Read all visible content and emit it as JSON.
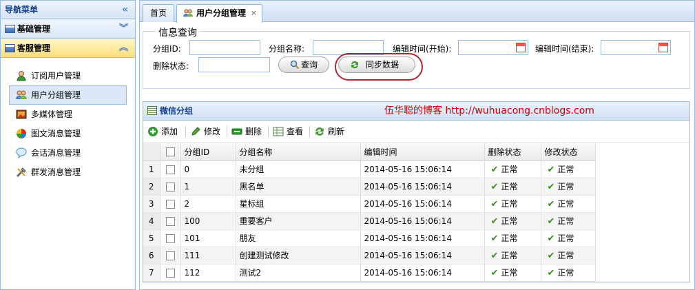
{
  "sidebar": {
    "title": "导航菜单",
    "sections": [
      {
        "label": "基础管理"
      },
      {
        "label": "客服管理"
      }
    ],
    "items": [
      {
        "label": "订阅用户管理"
      },
      {
        "label": "用户分组管理"
      },
      {
        "label": "多媒体管理"
      },
      {
        "label": "图文消息管理"
      },
      {
        "label": "会话消息管理"
      },
      {
        "label": "群发消息管理"
      }
    ]
  },
  "tabs": [
    {
      "label": "首页"
    },
    {
      "label": "用户分组管理"
    }
  ],
  "search": {
    "legend": "信息查询",
    "group_id_label": "分组ID:",
    "group_name_label": "分组名称:",
    "edit_start_label": "编辑时间(开始):",
    "edit_end_label": "编辑时间(结束):",
    "delete_status_label": "删除状态:",
    "query_button": "查询",
    "sync_button": "同步数据"
  },
  "grid": {
    "title": "微信分组",
    "blog_name": "伍华聪的博客",
    "blog_url": "http://wuhuacong.cnblogs.com",
    "toolbar": {
      "add": "添加",
      "edit": "修改",
      "delete": "删除",
      "view": "查看",
      "refresh": "刷新"
    },
    "columns": [
      "分组ID",
      "分组名称",
      "编辑时间",
      "删除状态",
      "修改状态"
    ],
    "rows": [
      {
        "n": "1",
        "id": "0",
        "name": "未分组",
        "time": "2014-05-16 15:06:14",
        "del": "正常",
        "mod": "正常"
      },
      {
        "n": "2",
        "id": "1",
        "name": "黑名单",
        "time": "2014-05-16 15:06:14",
        "del": "正常",
        "mod": "正常"
      },
      {
        "n": "3",
        "id": "2",
        "name": "星标组",
        "time": "2014-05-16 15:06:14",
        "del": "正常",
        "mod": "正常"
      },
      {
        "n": "4",
        "id": "100",
        "name": "重要客户",
        "time": "2014-05-16 15:06:14",
        "del": "正常",
        "mod": "正常"
      },
      {
        "n": "5",
        "id": "101",
        "name": "朋友",
        "time": "2014-05-16 15:06:14",
        "del": "正常",
        "mod": "正常"
      },
      {
        "n": "6",
        "id": "111",
        "name": "创建测试修改",
        "time": "2014-05-16 15:06:14",
        "del": "正常",
        "mod": "正常"
      },
      {
        "n": "7",
        "id": "112",
        "name": "测试2",
        "time": "2014-05-16 15:06:14",
        "del": "正常",
        "mod": "正常"
      }
    ]
  }
}
